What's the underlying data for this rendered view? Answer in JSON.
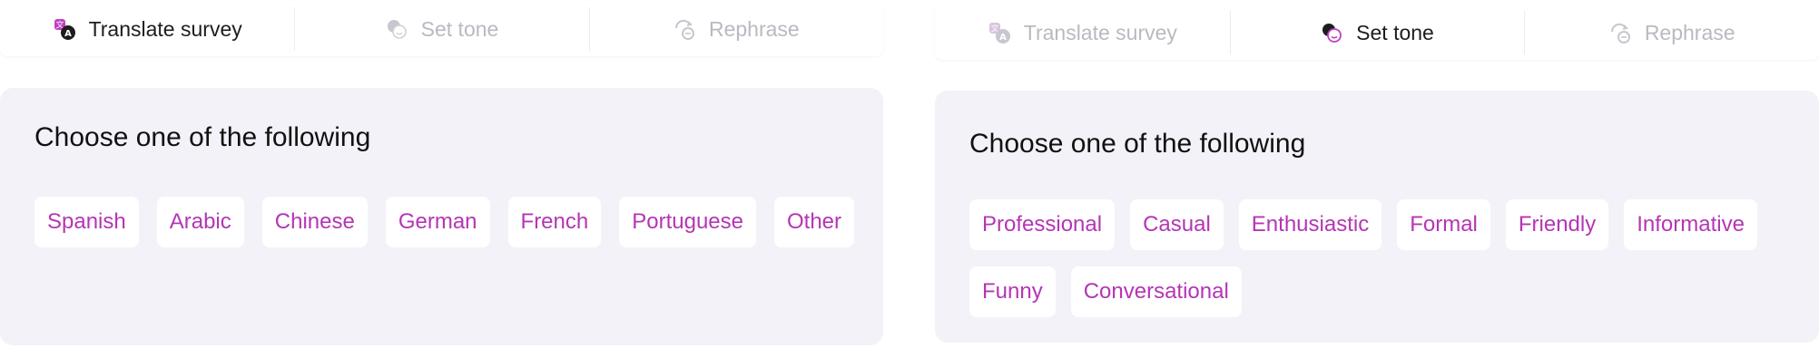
{
  "colors": {
    "accent": "#b535b5",
    "card_background": "#f3f2f8",
    "inactive_tab": "#b9b9c1",
    "active_tab": "#1d1d1f"
  },
  "panels": [
    {
      "tabs": [
        {
          "label": "Translate survey",
          "icon": "translate-icon",
          "active": true
        },
        {
          "label": "Set tone",
          "icon": "tone-icon",
          "active": false
        },
        {
          "label": "Rephrase",
          "icon": "rephrase-icon",
          "active": false
        }
      ],
      "title": "Choose one of the following",
      "options": [
        "Spanish",
        "Arabic",
        "Chinese",
        "German",
        "French",
        "Portuguese",
        "Other"
      ]
    },
    {
      "tabs": [
        {
          "label": "Translate survey",
          "icon": "translate-icon",
          "active": false
        },
        {
          "label": "Set tone",
          "icon": "tone-icon",
          "active": true
        },
        {
          "label": "Rephrase",
          "icon": "rephrase-icon",
          "active": false
        }
      ],
      "title": "Choose one of the following",
      "options": [
        "Professional",
        "Casual",
        "Enthusiastic",
        "Formal",
        "Friendly",
        "Informative",
        "Funny",
        "Conversational"
      ]
    }
  ]
}
